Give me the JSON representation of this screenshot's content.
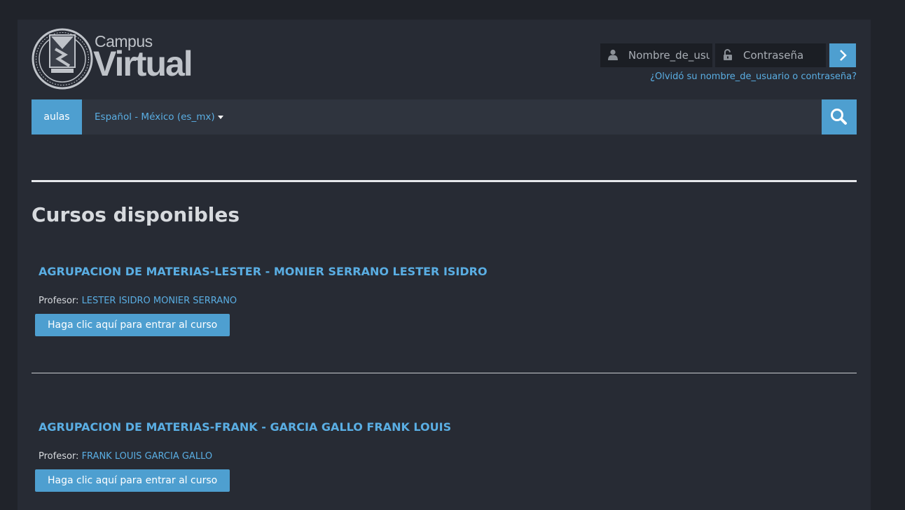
{
  "header": {
    "logo_top": "Campus",
    "logo_main": "Virtual"
  },
  "login": {
    "username_placeholder": "Nombre_de_usuario",
    "password_placeholder": "Contraseña",
    "forgot_link": "¿Olvidó su nombre_de_usuario o contraseña?"
  },
  "navbar": {
    "aulas_label": "aulas",
    "language_label": "Español - México (es_mx)"
  },
  "main": {
    "section_title": "Cursos disponibles",
    "courses": [
      {
        "title": "AGRUPACION DE MATERIAS-LESTER - MONIER SERRANO LESTER ISIDRO",
        "teacher_label": "Profesor:",
        "teacher_name": "LESTER ISIDRO MONIER SERRANO",
        "enter_label": "Haga clic aquí para entrar al curso"
      },
      {
        "title": "AGRUPACION DE MATERIAS-FRANK - GARCIA GALLO FRANK LOUIS",
        "teacher_label": "Profesor:",
        "teacher_name": "FRANK LOUIS GARCIA GALLO",
        "enter_label": "Haga clic aquí para entrar al curso"
      }
    ]
  },
  "colors": {
    "background": "#20232a",
    "page": "#272b34",
    "navbar": "#2f343e",
    "accent": "#4e9fd0",
    "link": "#5aaee3"
  },
  "icons": {
    "logo": "university-seal-icon",
    "username": "user-icon",
    "password": "unlock-icon",
    "login": "chevron-right-icon",
    "search": "search-icon",
    "language": "caret-down-icon"
  }
}
